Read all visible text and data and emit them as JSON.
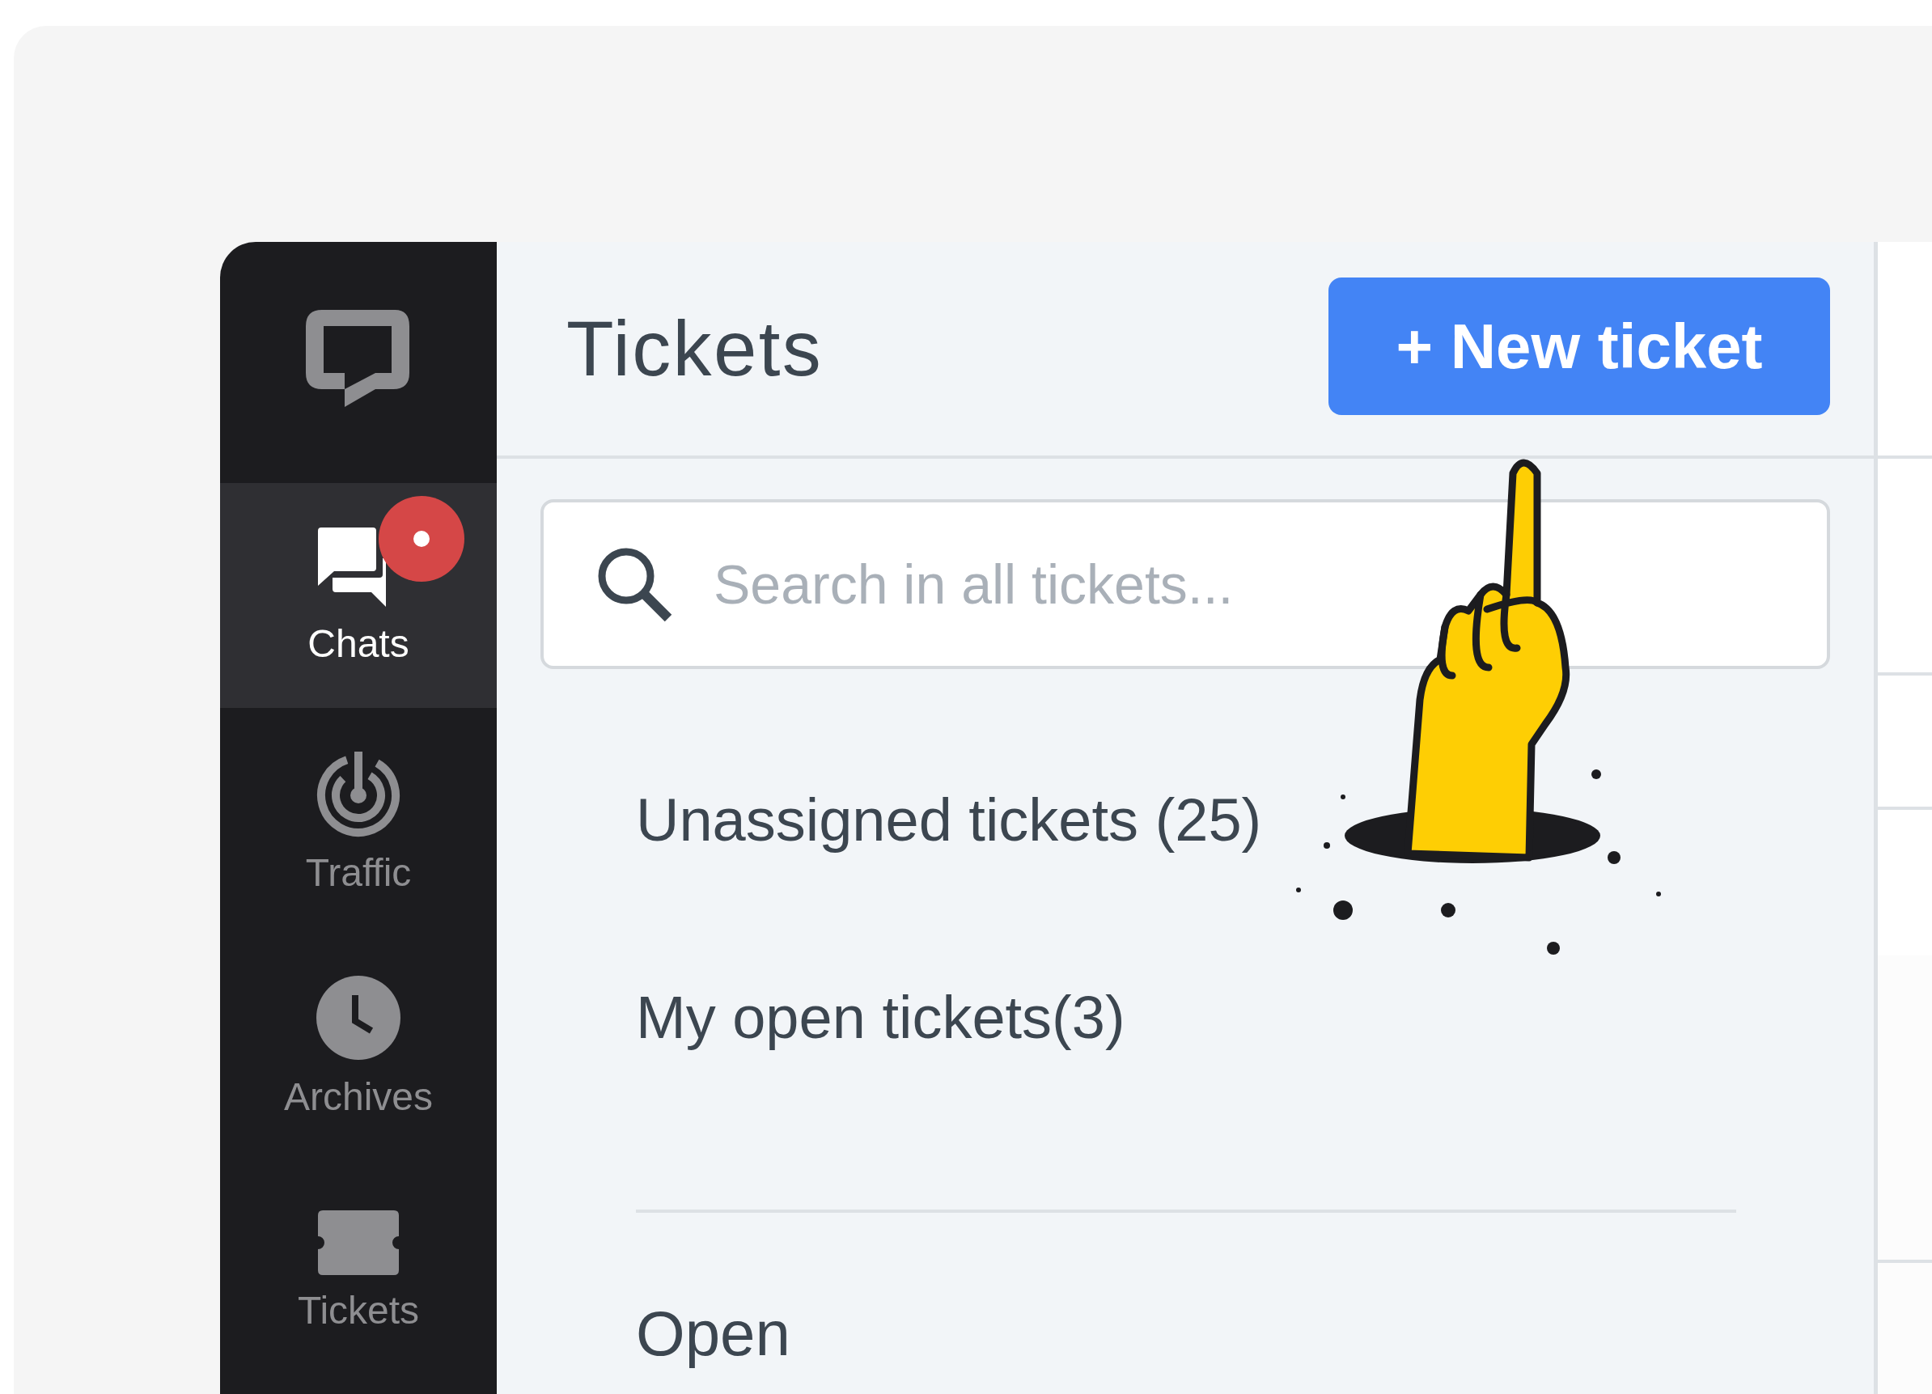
{
  "sidebar": {
    "items": [
      {
        "label": "Chats",
        "selected": true,
        "notification": true
      },
      {
        "label": "Traffic",
        "selected": false,
        "notification": false
      },
      {
        "label": "Archives",
        "selected": false,
        "notification": false
      },
      {
        "label": "Tickets",
        "selected": false,
        "notification": false
      }
    ]
  },
  "header": {
    "title": "Tickets",
    "new_button": "+ New ticket"
  },
  "search": {
    "placeholder": "Search in all tickets..."
  },
  "views": [
    "Unassigned tickets (25)",
    "My open tickets(3)"
  ],
  "section": {
    "title": "Open"
  }
}
